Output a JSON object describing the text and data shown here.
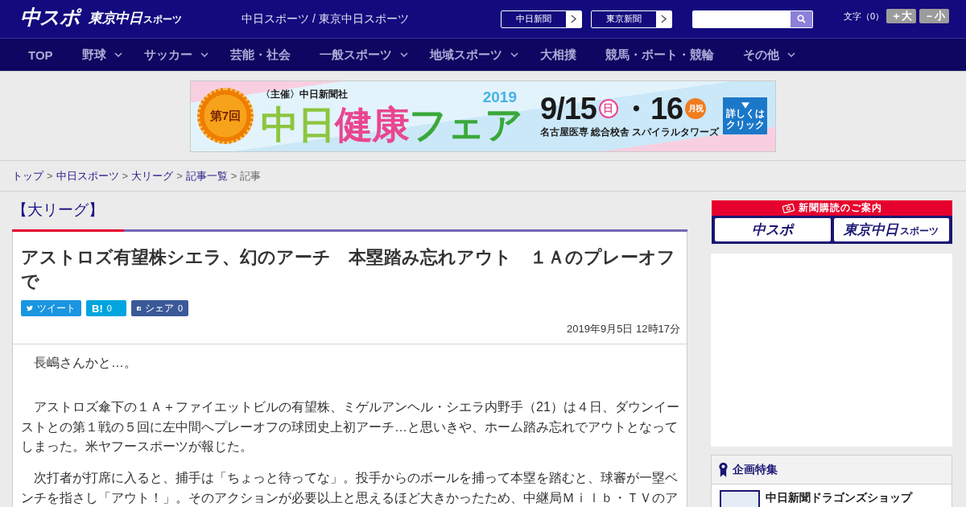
{
  "header": {
    "logo_main": "中スポ",
    "logo_sub": {
      "text": "東京中日",
      "small": "スポーツ"
    },
    "site_name": "中日スポーツ / 東京中日スポーツ",
    "paper_links": [
      {
        "label": "中日新聞"
      },
      {
        "label": "東京新聞"
      }
    ],
    "text_size": {
      "label": "文字（0）",
      "buttons": [
        "＋大",
        "－小"
      ]
    }
  },
  "nav": [
    {
      "label": "TOP",
      "has_menu": false
    },
    {
      "label": "野球",
      "has_menu": true
    },
    {
      "label": "サッカー",
      "has_menu": true
    },
    {
      "label": "芸能・社会",
      "has_menu": false
    },
    {
      "label": "一般スポーツ",
      "has_menu": true
    },
    {
      "label": "地域スポーツ",
      "has_menu": true
    },
    {
      "label": "大相撲",
      "has_menu": false
    },
    {
      "label": "競馬・ボート・競輪",
      "has_menu": false
    },
    {
      "label": "その他",
      "has_menu": true
    }
  ],
  "banner": {
    "edition": "第7回",
    "organizer": "〈主催〉中日新聞社",
    "year": "2019",
    "title_parts": [
      {
        "text": "中日",
        "color": "#8cc63f"
      },
      {
        "text": "健康",
        "color": "#e9468f"
      },
      {
        "text": "フェア",
        "color": "#3aa83a"
      }
    ],
    "date_parts": [
      {
        "kind": "number",
        "text": "9/15"
      },
      {
        "kind": "day",
        "text": "日",
        "color": "#e9468f"
      },
      {
        "kind": "number",
        "text": "・16"
      },
      {
        "kind": "holiday",
        "text": "月祝",
        "color": "#f07c1e"
      }
    ],
    "venue": "名古屋医専 総合校舎 スパイラルタワーズ",
    "cta": "詳しくはクリック"
  },
  "breadcrumb": [
    {
      "label": "トップ",
      "link": true
    },
    {
      "separator": ">",
      "label": "中日スポーツ",
      "link": true
    },
    {
      "separator": ">",
      "label": "大リーグ",
      "link": true
    },
    {
      "separator": ">",
      "label": "記事一覧",
      "link": true
    },
    {
      "separator": ">",
      "label": "記事",
      "link": false
    }
  ],
  "article": {
    "category": "【大リーグ】",
    "title": "アストロズ有望株シエラ、幻のアーチ　本塁踏み忘れアウト　１Ａのプレーオフで",
    "share": [
      {
        "kind": "twitter",
        "label": "ツイート"
      },
      {
        "kind": "hatena",
        "label": "B!",
        "count": "0"
      },
      {
        "kind": "facebook",
        "label": "シェア",
        "count": "0"
      }
    ],
    "date": "2019年9月5日 12時17分",
    "paragraphs": [
      "長嶋さんかと…。",
      "アストロズ傘下の１Ａ＋ファイエットビルの有望株、ミゲルアンヘル・シエラ内野手（21）は４日、ダウンイーストとの第１戦の５回に左中間へプレーオフの球団史上初アーチ…と思いきや、ホーム踏み忘れでアウトとなってしまった。米ヤフースポーツが報じた。",
      "次打者が打席に入ると、捕手は「ちょっと待ってな」。投手からのボールを捕って本塁を踏むと、球審が一塁ベンチを指さし「アウト！」。そのアクションが必要以上と思えるほど大きかったため、中継局Ｍｉｌｂ・ＴＶのア"
    ]
  },
  "sidebar": {
    "subscription": {
      "title": "新聞購読のご案内",
      "logos": [
        {
          "text": "中スポ"
        },
        {
          "text": "東京中日",
          "small": "スポーツ"
        }
      ]
    },
    "feature": {
      "title": "企画特集",
      "items": [
        {
          "title": "中日新聞ドラゴンズショップ"
        }
      ]
    }
  }
}
